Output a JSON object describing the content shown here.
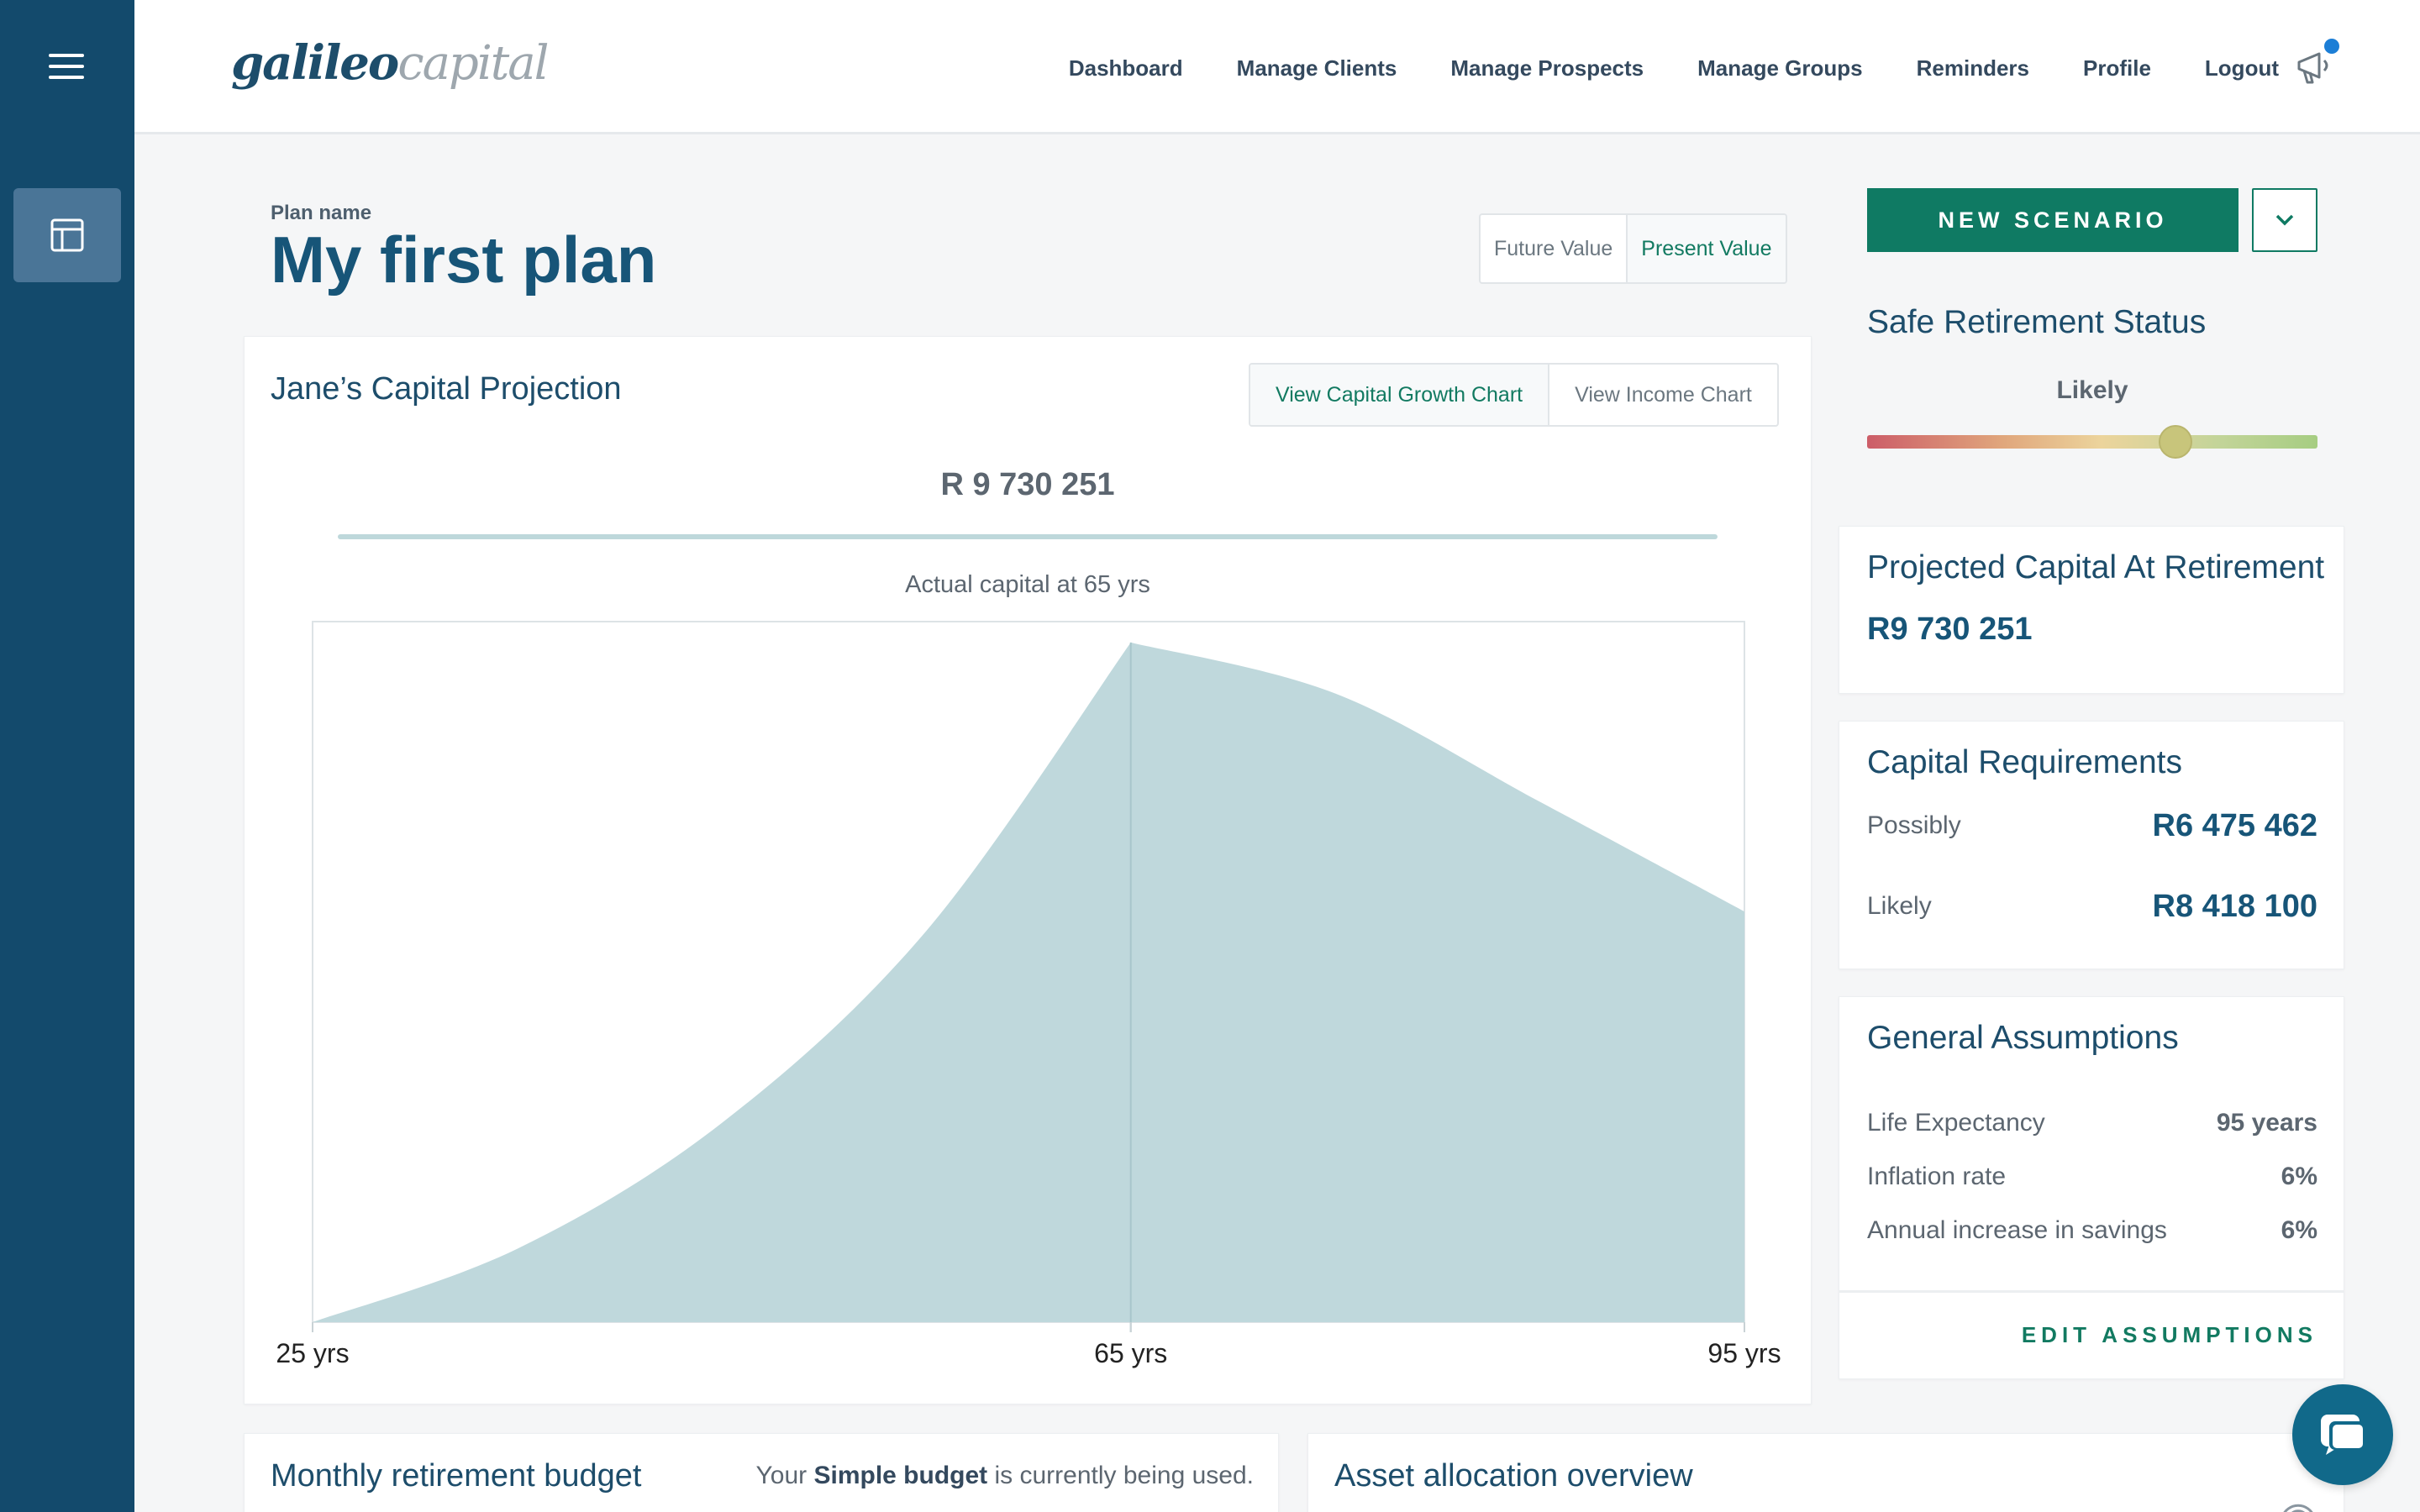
{
  "header": {
    "logo_bold": "galileo",
    "logo_light": "capital",
    "nav": [
      "Dashboard",
      "Manage Clients",
      "Manage Prospects",
      "Manage Groups",
      "Reminders",
      "Profile",
      "Logout"
    ]
  },
  "plan": {
    "label": "Plan name",
    "title": "My first plan",
    "value_toggle": [
      "Future Value",
      "Present Value"
    ],
    "value_toggle_selected": "Present Value"
  },
  "projection": {
    "title": "Jane’s Capital Projection",
    "chart_toggle": [
      "View Capital Growth Chart",
      "View Income Chart"
    ],
    "chart_toggle_selected": "View Capital Growth Chart",
    "peak_value": "R 9 730 251",
    "caption": "Actual capital at 65 yrs"
  },
  "chart_data": {
    "type": "area",
    "x": [
      25,
      35,
      45,
      55,
      65,
      75,
      85,
      95
    ],
    "values": [
      0,
      1050000,
      2850000,
      5600000,
      9730251,
      9000000,
      7450000,
      5880000
    ],
    "tick_labels": [
      "25 yrs",
      "65 yrs",
      "95 yrs"
    ],
    "tick_x": [
      25,
      65,
      95
    ],
    "xlim": [
      25,
      95
    ],
    "ylim": [
      0,
      10030000
    ],
    "marker_x": 65,
    "color": "#bfd8dc"
  },
  "sidebar": {
    "menu_icon": "hamburger-icon",
    "item_icon": "layout-icon"
  },
  "right": {
    "new_scenario": "NEW SCENARIO",
    "srs_title": "Safe Retirement Status",
    "srs_status": "Likely",
    "srs_position": 0.685,
    "projected_title": "Projected Capital At Retirement",
    "projected_value": "R9 730 251",
    "requirements_title": "Capital Requirements",
    "requirements": [
      {
        "label": "Possibly",
        "value": "R6 475 462"
      },
      {
        "label": "Likely",
        "value": "R8 418 100"
      }
    ],
    "assumptions_title": "General Assumptions",
    "assumptions": [
      {
        "label": "Life Expectancy",
        "value": "95 years"
      },
      {
        "label": "Inflation rate",
        "value": "6%"
      },
      {
        "label": "Annual increase in savings",
        "value": "6%"
      }
    ],
    "edit": "EDIT ASSUMPTIONS"
  },
  "bottom": {
    "budget_title": "Monthly retirement budget",
    "budget_note_pre": "Your ",
    "budget_note_bold": "Simple budget",
    "budget_note_post": " is currently being used.",
    "asset_title": "Asset allocation overview"
  },
  "colors": {
    "sidebar": "#134a6c",
    "accent_green": "#0f7a63",
    "chart_fill": "#bfd8dc",
    "chat": "#11698a"
  }
}
